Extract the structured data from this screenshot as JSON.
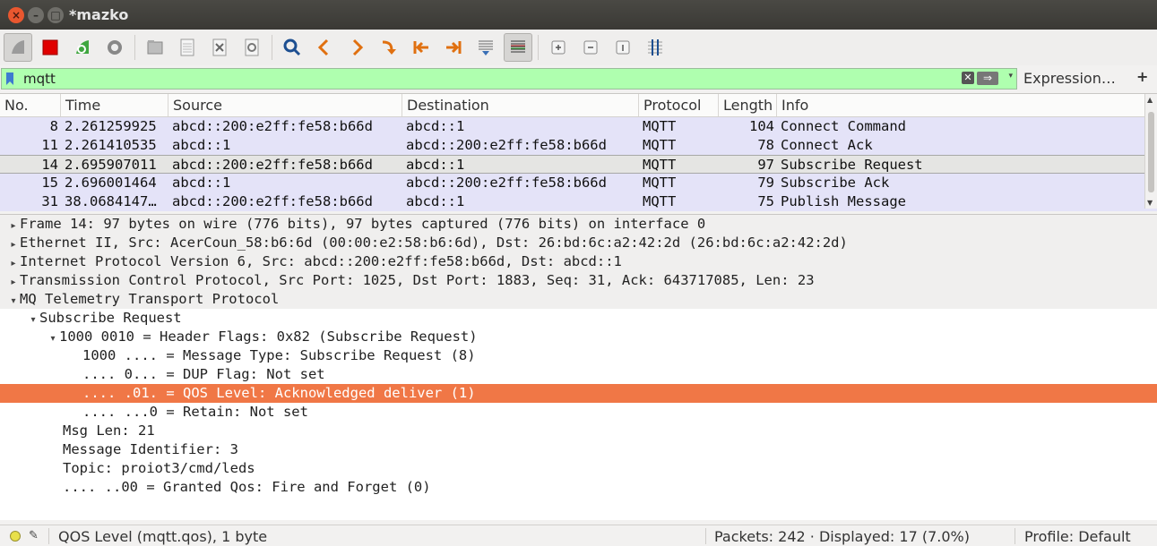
{
  "window": {
    "title": "*mazko"
  },
  "toolbar": {
    "buttons": [
      {
        "name": "start-capture-icon",
        "color": "#9b9b9b"
      },
      {
        "name": "stop-capture-icon",
        "color": "#e00000"
      },
      {
        "name": "restart-capture-icon",
        "color": "#3fa63f"
      },
      {
        "name": "capture-options-icon",
        "color": "#777777"
      },
      {
        "name": "open-file-icon",
        "color": "#999999"
      },
      {
        "name": "save-file-icon",
        "color": "#999999"
      },
      {
        "name": "close-file-icon",
        "color": "#999999"
      },
      {
        "name": "reload-file-icon",
        "color": "#999999"
      },
      {
        "name": "find-packet-icon",
        "color": "#1d4f91"
      },
      {
        "name": "go-back-icon",
        "color": "#e07010"
      },
      {
        "name": "go-forward-icon",
        "color": "#e07010"
      },
      {
        "name": "go-to-packet-icon",
        "color": "#e07010"
      },
      {
        "name": "go-first-icon",
        "color": "#e07010"
      },
      {
        "name": "go-last-icon",
        "color": "#e07010"
      },
      {
        "name": "autoscroll-icon",
        "color": "#555555"
      },
      {
        "name": "colorize-icon",
        "color": "#555555"
      },
      {
        "name": "zoom-in-icon",
        "color": "#777777"
      },
      {
        "name": "zoom-out-icon",
        "color": "#777777"
      },
      {
        "name": "normal-size-icon",
        "color": "#777777"
      },
      {
        "name": "resize-columns-icon",
        "color": "#555555"
      }
    ]
  },
  "filter": {
    "value": "mqtt",
    "expression_label": "Expression…",
    "plus_label": "+",
    "bg_color": "#afffaf"
  },
  "packet_list": {
    "columns": [
      "No.",
      "Time",
      "Source",
      "Destination",
      "Protocol",
      "Length",
      "Info"
    ],
    "rows": [
      {
        "no": "8",
        "time": "2.261259925",
        "src": "abcd::200:e2ff:fe58:b66d",
        "dst": "abcd::1",
        "proto": "MQTT",
        "len": "104",
        "info": "Connect Command"
      },
      {
        "no": "11",
        "time": "2.261410535",
        "src": "abcd::1",
        "dst": "abcd::200:e2ff:fe58:b66d",
        "proto": "MQTT",
        "len": "78",
        "info": "Connect Ack"
      },
      {
        "no": "14",
        "time": "2.695907011",
        "src": "abcd::200:e2ff:fe58:b66d",
        "dst": "abcd::1",
        "proto": "MQTT",
        "len": "97",
        "info": "Subscribe Request"
      },
      {
        "no": "15",
        "time": "2.696001464",
        "src": "abcd::1",
        "dst": "abcd::200:e2ff:fe58:b66d",
        "proto": "MQTT",
        "len": "79",
        "info": "Subscribe Ack"
      },
      {
        "no": "31",
        "time": "38.0684147…",
        "src": "abcd::200:e2ff:fe58:b66d",
        "dst": "abcd::1",
        "proto": "MQTT",
        "len": "75",
        "info": "Publish Message"
      }
    ],
    "row_color": "#e4e3f8"
  },
  "details": {
    "lines": [
      {
        "text": "Frame 14: 97 bytes on wire (776 bits), 97 bytes captured (776 bits) on interface 0",
        "arrow": "▸"
      },
      {
        "text": "Ethernet II, Src: AcerCoun_58:b6:6d (00:00:e2:58:b6:6d), Dst: 26:bd:6c:a2:42:2d (26:bd:6c:a2:42:2d)",
        "arrow": "▸"
      },
      {
        "text": "Internet Protocol Version 6, Src: abcd::200:e2ff:fe58:b66d, Dst: abcd::1",
        "arrow": "▸"
      },
      {
        "text": "Transmission Control Protocol, Src Port: 1025, Dst Port: 1883, Seq: 31, Ack: 643717085, Len: 23",
        "arrow": "▸"
      },
      {
        "text": "MQ Telemetry Transport Protocol",
        "arrow": "▾"
      },
      {
        "text": "Subscribe Request",
        "arrow": "▾"
      },
      {
        "text": "1000 0010 = Header Flags: 0x82 (Subscribe Request)",
        "arrow": "▾"
      },
      {
        "text": "1000 .... = Message Type: Subscribe Request (8)",
        "arrow": ""
      },
      {
        "text": ".... 0... = DUP Flag: Not set",
        "arrow": ""
      },
      {
        "text": ".... .01. = QOS Level: Acknowledged deliver (1)",
        "arrow": ""
      },
      {
        "text": ".... ...0 = Retain: Not set",
        "arrow": ""
      },
      {
        "text": "Msg Len: 21",
        "arrow": ""
      },
      {
        "text": "Message Identifier: 3",
        "arrow": ""
      },
      {
        "text": "Topic: proiot3/cmd/leds",
        "arrow": ""
      },
      {
        "text": ".... ..00 = Granted Qos: Fire and Forget (0)",
        "arrow": ""
      }
    ],
    "highlight_color": "#f07746"
  },
  "status": {
    "field_info": "QOS Level (mqtt.qos), 1 byte",
    "packets": "Packets: 242 · Displayed: 17 (7.0%)",
    "profile": "Profile: Default"
  }
}
